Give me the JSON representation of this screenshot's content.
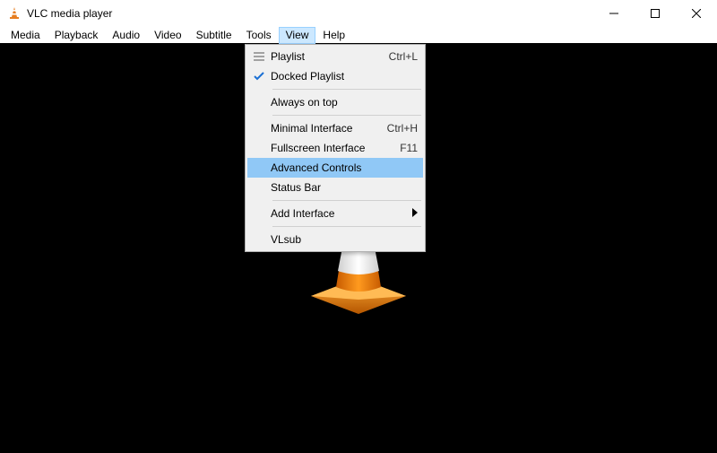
{
  "window": {
    "title": "VLC media player"
  },
  "menubar": {
    "items": [
      {
        "label": "Media"
      },
      {
        "label": "Playback"
      },
      {
        "label": "Audio"
      },
      {
        "label": "Video"
      },
      {
        "label": "Subtitle"
      },
      {
        "label": "Tools"
      },
      {
        "label": "View"
      },
      {
        "label": "Help"
      }
    ],
    "open_index": 6
  },
  "view_menu": {
    "items": [
      {
        "label": "Playlist",
        "accel": "Ctrl+L",
        "icon": "list-icon"
      },
      {
        "label": "Docked Playlist",
        "checked": true
      },
      {
        "sep": true
      },
      {
        "label": "Always on top"
      },
      {
        "sep": true
      },
      {
        "label": "Minimal Interface",
        "accel": "Ctrl+H"
      },
      {
        "label": "Fullscreen Interface",
        "accel": "F11"
      },
      {
        "label": "Advanced Controls",
        "highlighted": true
      },
      {
        "label": "Status Bar"
      },
      {
        "sep": true
      },
      {
        "label": "Add Interface",
        "submenu": true
      },
      {
        "sep": true
      },
      {
        "label": "VLsub"
      }
    ]
  }
}
